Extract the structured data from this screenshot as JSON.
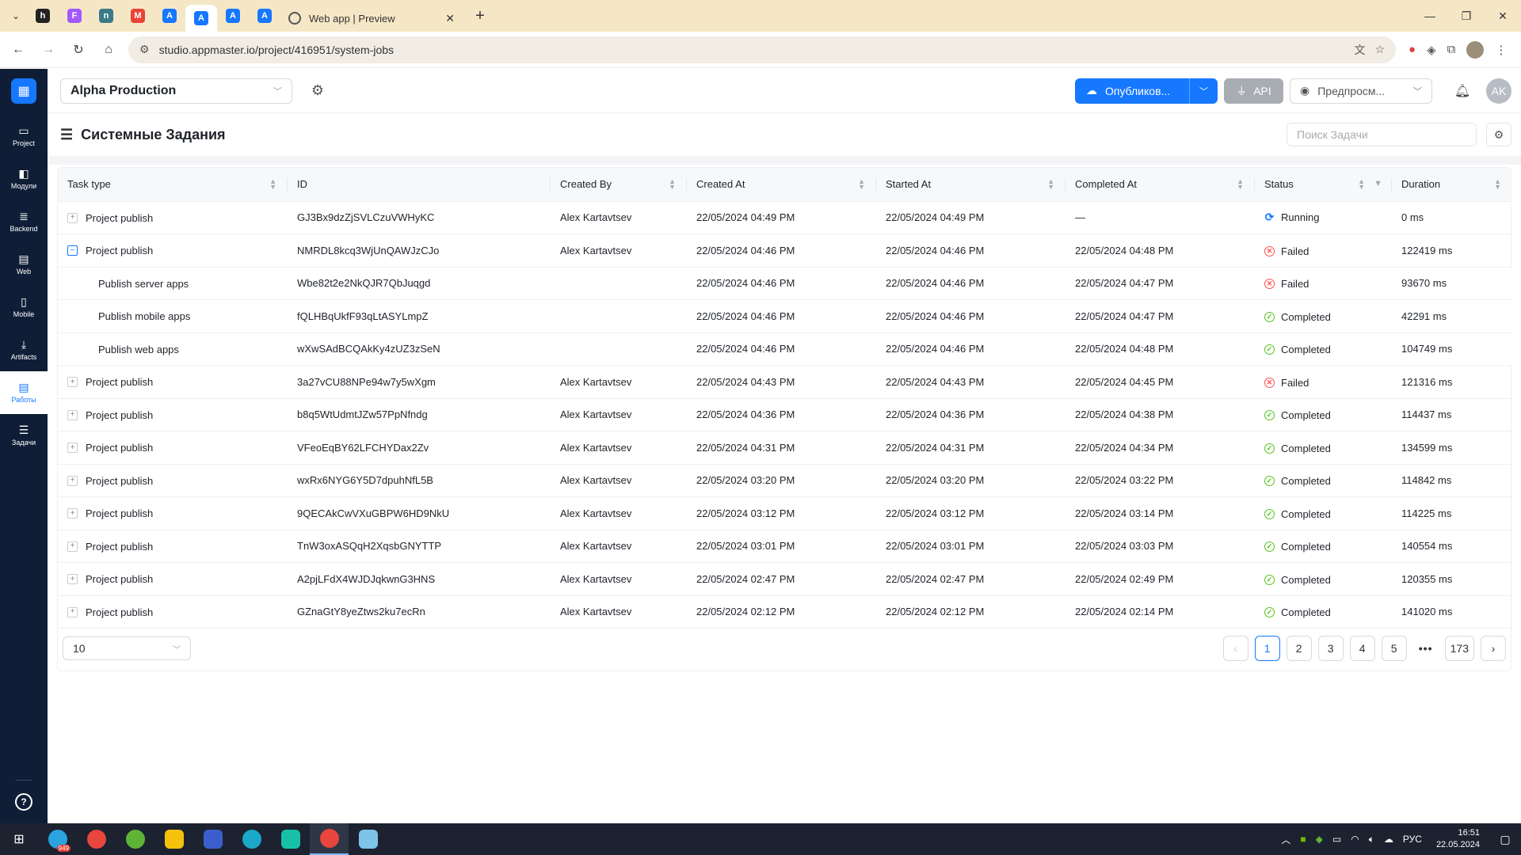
{
  "browser": {
    "tab_title": "Web app | Preview",
    "url": "studio.appmaster.io/project/416951/system-jobs",
    "pinned_tabs": [
      {
        "icon": "letter-h-icon",
        "color": "#222222",
        "text": "h"
      },
      {
        "icon": "figma-icon",
        "color": "#a259ff",
        "text": "F"
      },
      {
        "icon": "app-icon",
        "color": "#3c7a89",
        "text": "n"
      },
      {
        "icon": "gmail-icon",
        "color": "#ea4335",
        "text": "M"
      },
      {
        "icon": "appmaster-icon",
        "color": "#1677ff",
        "text": "A"
      },
      {
        "icon": "appmaster-icon",
        "color": "#1677ff",
        "text": "A"
      },
      {
        "icon": "appmaster-icon",
        "color": "#1677ff",
        "text": "A"
      },
      {
        "icon": "appmaster-icon",
        "color": "#1677ff",
        "text": "A"
      }
    ]
  },
  "sidebar": {
    "items": [
      {
        "label": "Project",
        "icon": "folder-icon"
      },
      {
        "label": "Модули",
        "icon": "modules-icon"
      },
      {
        "label": "Backend",
        "icon": "backend-icon"
      },
      {
        "label": "Web",
        "icon": "web-icon"
      },
      {
        "label": "Mobile",
        "icon": "mobile-icon"
      },
      {
        "label": "Artifacts",
        "icon": "download-icon"
      },
      {
        "label": "Работы",
        "icon": "jobs-icon",
        "active": true
      },
      {
        "label": "Задачи",
        "icon": "tasks-icon"
      }
    ]
  },
  "topbar": {
    "project": "Alpha Production",
    "publish_label": "Опубликов...",
    "api_label": "API",
    "preview_label": "Предпросм...",
    "avatar": "AK"
  },
  "page": {
    "title": "Системные Задания",
    "search_placeholder": "Поиск Задачи"
  },
  "table": {
    "columns": [
      "Task type",
      "ID",
      "Created By",
      "Created At",
      "Started At",
      "Completed At",
      "Status",
      "Duration"
    ],
    "rows": [
      {
        "type": "Project publish",
        "expand": "+",
        "id": "GJ3Bx9dzZjSVLCzuVWHyKC",
        "by": "Alex Kartavtsev",
        "created": "22/05/2024 04:49 PM",
        "started": "22/05/2024 04:49 PM",
        "completed": "—",
        "status": "Running",
        "duration": "0 ms"
      },
      {
        "type": "Project publish",
        "expand": "−",
        "open": true,
        "id": "NMRDL8kcq3WjUnQAWJzCJo",
        "by": "Alex Kartavtsev",
        "created": "22/05/2024 04:46 PM",
        "started": "22/05/2024 04:46 PM",
        "completed": "22/05/2024 04:48 PM",
        "status": "Failed",
        "duration": "122419 ms"
      },
      {
        "type": "Publish server apps",
        "child": true,
        "id": "Wbe82t2e2NkQJR7QbJuqgd",
        "by": "",
        "created": "22/05/2024 04:46 PM",
        "started": "22/05/2024 04:46 PM",
        "completed": "22/05/2024 04:47 PM",
        "status": "Failed",
        "duration": "93670 ms"
      },
      {
        "type": "Publish mobile apps",
        "child": true,
        "id": "fQLHBqUkfF93qLtASYLmpZ",
        "by": "",
        "created": "22/05/2024 04:46 PM",
        "started": "22/05/2024 04:46 PM",
        "completed": "22/05/2024 04:47 PM",
        "status": "Completed",
        "duration": "42291 ms"
      },
      {
        "type": "Publish web apps",
        "child": true,
        "id": "wXwSAdBCQAkKy4zUZ3zSeN",
        "by": "",
        "created": "22/05/2024 04:46 PM",
        "started": "22/05/2024 04:46 PM",
        "completed": "22/05/2024 04:48 PM",
        "status": "Completed",
        "duration": "104749 ms"
      },
      {
        "type": "Project publish",
        "expand": "+",
        "id": "3a27vCU88NPe94w7y5wXgm",
        "by": "Alex Kartavtsev",
        "created": "22/05/2024 04:43 PM",
        "started": "22/05/2024 04:43 PM",
        "completed": "22/05/2024 04:45 PM",
        "status": "Failed",
        "duration": "121316 ms"
      },
      {
        "type": "Project publish",
        "expand": "+",
        "id": "b8q5WtUdmtJZw57PpNfndg",
        "by": "Alex Kartavtsev",
        "created": "22/05/2024 04:36 PM",
        "started": "22/05/2024 04:36 PM",
        "completed": "22/05/2024 04:38 PM",
        "status": "Completed",
        "duration": "114437 ms"
      },
      {
        "type": "Project publish",
        "expand": "+",
        "id": "VFeoEqBY62LFCHYDax2Zv",
        "by": "Alex Kartavtsev",
        "created": "22/05/2024 04:31 PM",
        "started": "22/05/2024 04:31 PM",
        "completed": "22/05/2024 04:34 PM",
        "status": "Completed",
        "duration": "134599 ms"
      },
      {
        "type": "Project publish",
        "expand": "+",
        "id": "wxRx6NYG6Y5D7dpuhNfL5B",
        "by": "Alex Kartavtsev",
        "created": "22/05/2024 03:20 PM",
        "started": "22/05/2024 03:20 PM",
        "completed": "22/05/2024 03:22 PM",
        "status": "Completed",
        "duration": "114842 ms"
      },
      {
        "type": "Project publish",
        "expand": "+",
        "id": "9QECAkCwVXuGBPW6HD9NkU",
        "by": "Alex Kartavtsev",
        "created": "22/05/2024 03:12 PM",
        "started": "22/05/2024 03:12 PM",
        "completed": "22/05/2024 03:14 PM",
        "status": "Completed",
        "duration": "114225 ms"
      },
      {
        "type": "Project publish",
        "expand": "+",
        "id": "TnW3oxASQqH2XqsbGNYTTP",
        "by": "Alex Kartavtsev",
        "created": "22/05/2024 03:01 PM",
        "started": "22/05/2024 03:01 PM",
        "completed": "22/05/2024 03:03 PM",
        "status": "Completed",
        "duration": "140554 ms"
      },
      {
        "type": "Project publish",
        "expand": "+",
        "id": "A2pjLFdX4WJDJqkwnG3HNS",
        "by": "Alex Kartavtsev",
        "created": "22/05/2024 02:47 PM",
        "started": "22/05/2024 02:47 PM",
        "completed": "22/05/2024 02:49 PM",
        "status": "Completed",
        "duration": "120355 ms"
      },
      {
        "type": "Project publish",
        "expand": "+",
        "id": "GZnaGtY8yeZtws2ku7ecRn",
        "by": "Alex Kartavtsev",
        "created": "22/05/2024 02:12 PM",
        "started": "22/05/2024 02:12 PM",
        "completed": "22/05/2024 02:14 PM",
        "status": "Completed",
        "duration": "141020 ms"
      }
    ]
  },
  "pagination": {
    "page_size": "10",
    "pages": [
      "1",
      "2",
      "3",
      "4",
      "5"
    ],
    "current": "1",
    "more": "•••",
    "last": "173"
  },
  "taskbar": {
    "apps": [
      {
        "icon": "telegram-icon",
        "color": "#2aa3e0",
        "badge": "949"
      },
      {
        "icon": "chrome-icon",
        "color": "#e8453c"
      },
      {
        "icon": "utorrent-icon",
        "color": "#5fb336"
      },
      {
        "icon": "app-warning-icon",
        "color": "#f4c20d"
      },
      {
        "icon": "floppy-icon",
        "color": "#3a5fcd"
      },
      {
        "icon": "edge-icon",
        "color": "#1ba8c9"
      },
      {
        "icon": "media-icon",
        "color": "#18c0a8"
      },
      {
        "icon": "chrome-icon",
        "color": "#e8453c",
        "active": true
      },
      {
        "icon": "notepad-icon",
        "color": "#7ec4e8"
      }
    ],
    "lang": "РУС",
    "time": "16:51",
    "date": "22.05.2024"
  },
  "colors": {
    "accent": "#1677ff",
    "sidebar_bg": "#0f1e36",
    "success": "#52c41a",
    "error": "#ff4d4f",
    "tabstrip": "#f5e7c6"
  }
}
